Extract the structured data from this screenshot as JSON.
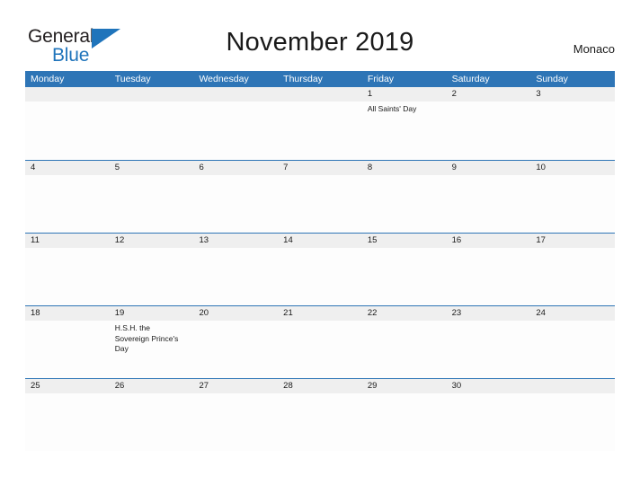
{
  "brand": {
    "name_part1": "General",
    "name_part2": "Blue",
    "flag_icon": "triangle-flag-icon",
    "accent_color": "#1f74bb"
  },
  "header": {
    "title": "November 2019",
    "locale": "Monaco"
  },
  "theme": {
    "header_blue": "#2e75b6",
    "day_band_gray": "#efefef",
    "cell_background": "#fdfdfd",
    "text_color": "#1a1a1a"
  },
  "calendar": {
    "month": "November",
    "year": "2019",
    "weekday_headers": [
      "Monday",
      "Tuesday",
      "Wednesday",
      "Thursday",
      "Friday",
      "Saturday",
      "Sunday"
    ],
    "weeks": [
      [
        {
          "day": "",
          "events": []
        },
        {
          "day": "",
          "events": []
        },
        {
          "day": "",
          "events": []
        },
        {
          "day": "",
          "events": []
        },
        {
          "day": "1",
          "events": [
            "All Saints' Day"
          ]
        },
        {
          "day": "2",
          "events": []
        },
        {
          "day": "3",
          "events": []
        }
      ],
      [
        {
          "day": "4",
          "events": []
        },
        {
          "day": "5",
          "events": []
        },
        {
          "day": "6",
          "events": []
        },
        {
          "day": "7",
          "events": []
        },
        {
          "day": "8",
          "events": []
        },
        {
          "day": "9",
          "events": []
        },
        {
          "day": "10",
          "events": []
        }
      ],
      [
        {
          "day": "11",
          "events": []
        },
        {
          "day": "12",
          "events": []
        },
        {
          "day": "13",
          "events": []
        },
        {
          "day": "14",
          "events": []
        },
        {
          "day": "15",
          "events": []
        },
        {
          "day": "16",
          "events": []
        },
        {
          "day": "17",
          "events": []
        }
      ],
      [
        {
          "day": "18",
          "events": []
        },
        {
          "day": "19",
          "events": [
            "H.S.H. the Sovereign Prince's Day"
          ]
        },
        {
          "day": "20",
          "events": []
        },
        {
          "day": "21",
          "events": []
        },
        {
          "day": "22",
          "events": []
        },
        {
          "day": "23",
          "events": []
        },
        {
          "day": "24",
          "events": []
        }
      ],
      [
        {
          "day": "25",
          "events": []
        },
        {
          "day": "26",
          "events": []
        },
        {
          "day": "27",
          "events": []
        },
        {
          "day": "28",
          "events": []
        },
        {
          "day": "29",
          "events": []
        },
        {
          "day": "30",
          "events": []
        },
        {
          "day": "",
          "events": []
        }
      ]
    ]
  }
}
